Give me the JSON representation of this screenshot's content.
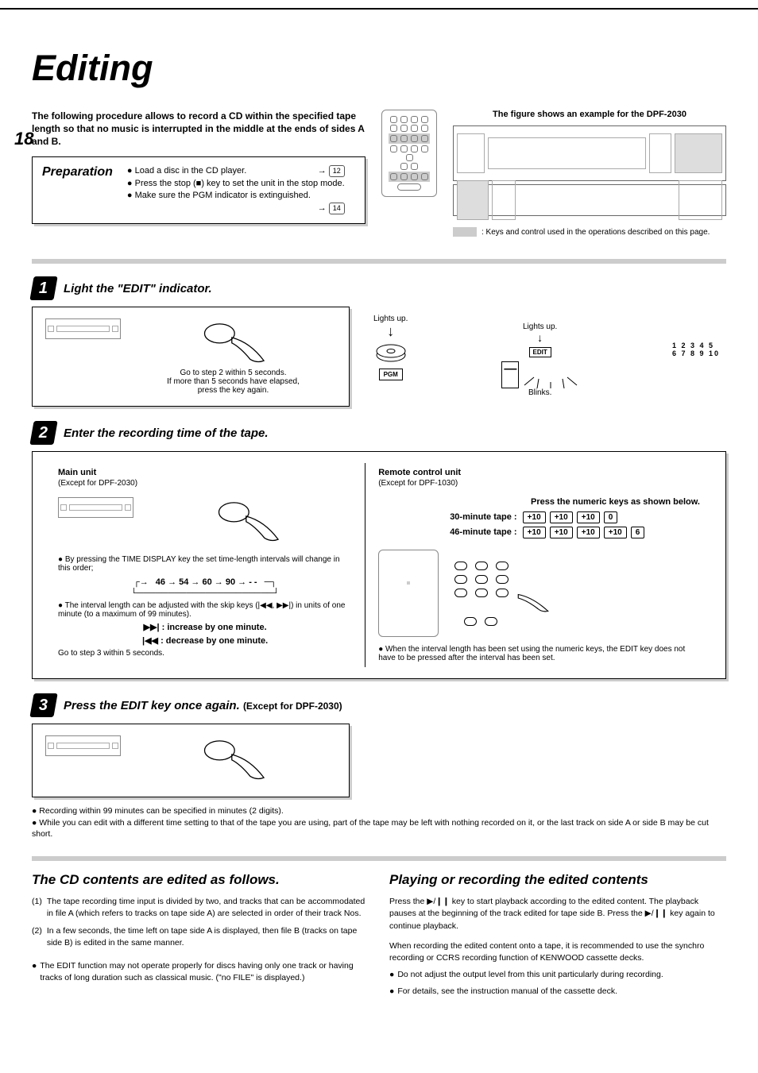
{
  "page_number": "18",
  "title": "Editing",
  "intro": "The following procedure allows to record a CD within the specified tape length so that no music is interrupted in the middle at the ends of sides A and B.",
  "preparation": {
    "title": "Preparation",
    "items": [
      "Load a disc in the CD player.",
      "Press the stop (■) key to set the unit in the stop mode.",
      "Make sure the PGM indicator is extinguished."
    ],
    "page_refs": [
      "12",
      "14"
    ]
  },
  "figure_caption": "The figure shows an example for the DPF-2030",
  "legend_text": ": Keys and control used in the operations described on this page.",
  "step1": {
    "title": "Light the \"EDIT\" indicator.",
    "caption": "Go to step 2 within 5 seconds.\nIf more than 5 seconds have elapsed,\npress the key again.",
    "lights_up": "Lights up.",
    "blinks": "Blinks.",
    "pgm": "PGM",
    "edit": "EDIT",
    "tracks_line1": "1   2   3   4   5",
    "tracks_line2": "6   7   8   9   10"
  },
  "step2": {
    "title": "Enter the recording time of the tape.",
    "left": {
      "head": "Main unit",
      "sub": "(Except for DPF-2030)",
      "note1": "By pressing the TIME DISPLAY key the set time-length intervals will change in this order;",
      "sequence": "46 → 54 → 60 → 90 → - -",
      "note2": "The interval length can be adjusted with the skip keys (|◀◀, ▶▶|) in units of one minute (to a maximum of 99 minutes).",
      "inc": "▶▶| : increase by one minute.",
      "dec": "|◀◀ : decrease by one minute.",
      "goto": "Go to step 3 within 5 seconds."
    },
    "right": {
      "head": "Remote control unit",
      "sub": "(Except for DPF-1030)",
      "instr": "Press the numeric keys as shown below.",
      "ex30_label": "30-minute tape",
      "ex30_keys": [
        "+10",
        "+10",
        "+10",
        "0"
      ],
      "ex46_label": "46-minute tape",
      "ex46_keys": [
        "+10",
        "+10",
        "+10",
        "+10",
        "6"
      ],
      "foot": "When the interval length has been set using the numeric keys, the EDIT key does not have to be pressed after the interval has been set."
    }
  },
  "step3": {
    "title": "Press the EDIT key once again.",
    "note": "(Except for DPF-2030)"
  },
  "footnotes": [
    "Recording within 99 minutes can be specified in minutes (2 digits).",
    "While you can edit with a different time setting to that of the tape you are using, part of the tape may be left with nothing recorded on it, or the last track on side A or side B may be cut short."
  ],
  "left_col": {
    "title": "The CD contents are edited as follows.",
    "items": [
      "The tape recording time input is divided by two, and tracks that can be accommodated in file A (which refers to tracks on tape side A) are selected in order of their track Nos.",
      "In a few seconds, the time left on tape side A is displayed, then file B (tracks on tape side B) is edited in the same manner."
    ],
    "warning": "The EDIT function may not operate properly for discs having only one track or having tracks of long duration such as classical music. (\"no FILE\" is displayed.)"
  },
  "right_col": {
    "title": "Playing or recording the edited contents",
    "p1": "Press the ▶/❙❙ key to start playback according to the edited content. The playback pauses at the beginning of the track edited for tape side B. Press the ▶/❙❙ key again to continue playback.",
    "p2": "When recording the edited content onto a tape, it is recommended to use the synchro recording or CCRS recording function of KENWOOD cassette decks.",
    "bullets": [
      "Do not adjust the output level from this unit particularly during recording.",
      "For details, see the instruction manual of the cassette deck."
    ]
  }
}
